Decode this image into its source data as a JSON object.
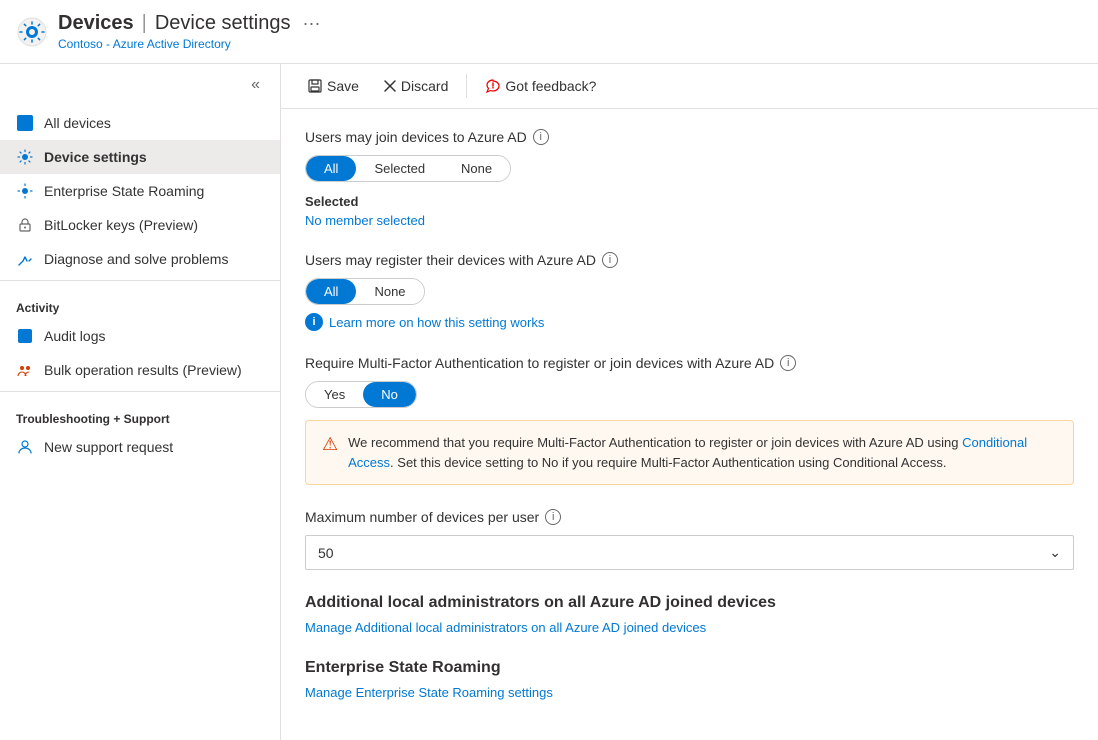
{
  "header": {
    "app_icon": "⚙",
    "app_title": "Devices",
    "separator": "|",
    "page_title": "Device settings",
    "ellipsis": "···",
    "breadcrumb": "Contoso - Azure Active Directory"
  },
  "toolbar": {
    "save_label": "Save",
    "discard_label": "Discard",
    "feedback_label": "Got feedback?"
  },
  "sidebar": {
    "collapse_icon": "«",
    "items": [
      {
        "id": "all-devices",
        "label": "All devices",
        "icon": "square",
        "active": false
      },
      {
        "id": "device-settings",
        "label": "Device settings",
        "icon": "gear",
        "active": true
      },
      {
        "id": "enterprise-state-roaming",
        "label": "Enterprise State Roaming",
        "icon": "gear",
        "active": false
      },
      {
        "id": "bitlocker-keys",
        "label": "BitLocker keys (Preview)",
        "icon": "key",
        "active": false
      },
      {
        "id": "diagnose-solve",
        "label": "Diagnose and solve problems",
        "icon": "wrench",
        "active": false
      }
    ],
    "activity_label": "Activity",
    "activity_items": [
      {
        "id": "audit-logs",
        "label": "Audit logs",
        "icon": "book"
      },
      {
        "id": "bulk-operations",
        "label": "Bulk operation results (Preview)",
        "icon": "people"
      }
    ],
    "troubleshooting_label": "Troubleshooting + Support",
    "support_items": [
      {
        "id": "new-support-request",
        "label": "New support request",
        "icon": "person"
      }
    ]
  },
  "settings": {
    "join_devices": {
      "label": "Users may join devices to Azure AD",
      "options": [
        "All",
        "Selected",
        "None"
      ],
      "active_option": "All",
      "selected_label": "Selected",
      "no_member_text": "No member selected"
    },
    "register_devices": {
      "label": "Users may register their devices with Azure AD",
      "options": [
        "All",
        "None"
      ],
      "active_option": "All",
      "learn_more_text": "Learn more on how this setting works"
    },
    "mfa": {
      "label": "Require Multi-Factor Authentication to register or join devices with Azure AD",
      "options": [
        "Yes",
        "No"
      ],
      "active_option": "No",
      "warning_text": "We recommend that you require Multi-Factor Authentication to register or join devices with Azure AD using ",
      "warning_link1": "Conditional Access",
      "warning_text2": ". Set this device setting to No if you require Multi-Factor Authentication using Conditional Access.",
      "warning_link2": "Conditional Access"
    },
    "max_devices": {
      "label": "Maximum number of devices per user",
      "value": "50",
      "options": [
        "50"
      ]
    },
    "additional_admins": {
      "heading": "Additional local administrators on all Azure AD joined devices",
      "link_text": "Manage Additional local administrators on all Azure AD joined devices"
    },
    "enterprise_state_roaming": {
      "heading": "Enterprise State Roaming",
      "link_text": "Manage Enterprise State Roaming settings"
    }
  }
}
